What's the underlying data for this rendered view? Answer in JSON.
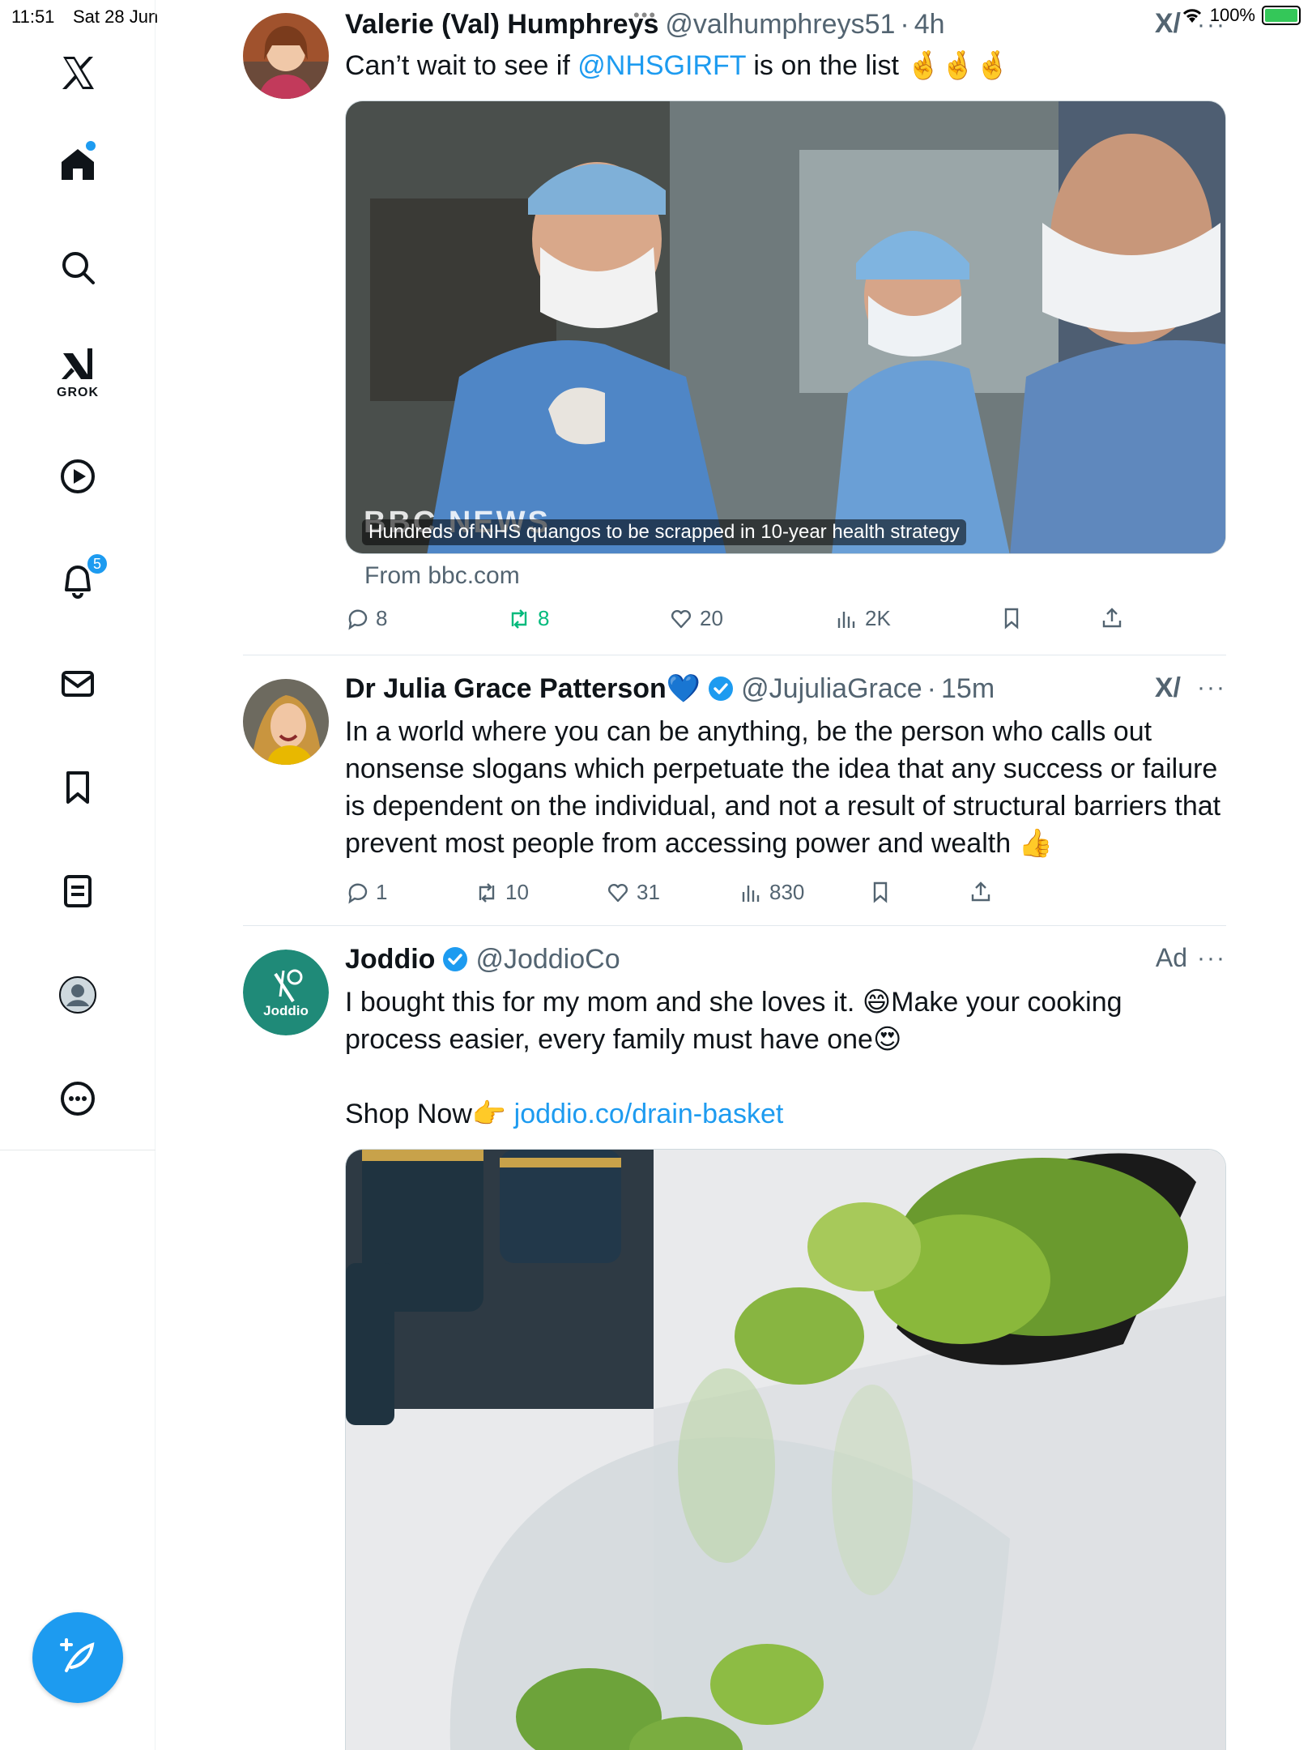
{
  "status": {
    "time": "11:51",
    "date": "Sat 28 Jun",
    "battery": "100%"
  },
  "sidebar": {
    "items": [
      {
        "name": "x-logo"
      },
      {
        "name": "home"
      },
      {
        "name": "explore"
      },
      {
        "name": "grok",
        "label": "GROK"
      },
      {
        "name": "video"
      },
      {
        "name": "notifications",
        "badge": "5"
      },
      {
        "name": "messages"
      },
      {
        "name": "bookmarks"
      },
      {
        "name": "lists"
      },
      {
        "name": "profile"
      },
      {
        "name": "more"
      }
    ]
  },
  "tweets": [
    {
      "name": "Valerie (Val) Humphreys",
      "handle": "@valhumphreys51",
      "time": "4h",
      "text_before": "Can’t wait to see if ",
      "mention": "@NHSGIRFT",
      "text_after": " is on the list 🤞🤞🤞",
      "media_caption": "Hundreds of NHS quangos to be scrapped in 10-year health strategy",
      "media_brand": "BBC NEWS",
      "source": "From bbc.com",
      "replies": "8",
      "reposts": "8",
      "likes": "20",
      "views": "2K"
    },
    {
      "name": "Dr Julia Grace Patterson💙",
      "handle": "@JujuliaGrace",
      "time": "15m",
      "text": "In a world where you can be anything, be the person who calls out nonsense slogans  which perpetuate the idea that any success or failure is dependent on the individual, and not a result of structural barriers that prevent most people from accessing power and wealth 👍",
      "replies": "1",
      "reposts": "10",
      "likes": "31",
      "views": "830"
    },
    {
      "name": "Joddio",
      "handle": "@JoddioCo",
      "ad_label": "Ad",
      "avatar_text": "Joddio",
      "line1": "I bought this for my mom and she loves it. 😄Make your cooking",
      "line2": "process easier, every family must have one😍",
      "shop_text": "Shop Now👉 ",
      "shop_link": "joddio.co/drain-basket"
    }
  ],
  "colors": {
    "accent": "#1d9bf0",
    "repost": "#00ba7c",
    "muted": "#536471",
    "joddio": "#1f8a78"
  }
}
